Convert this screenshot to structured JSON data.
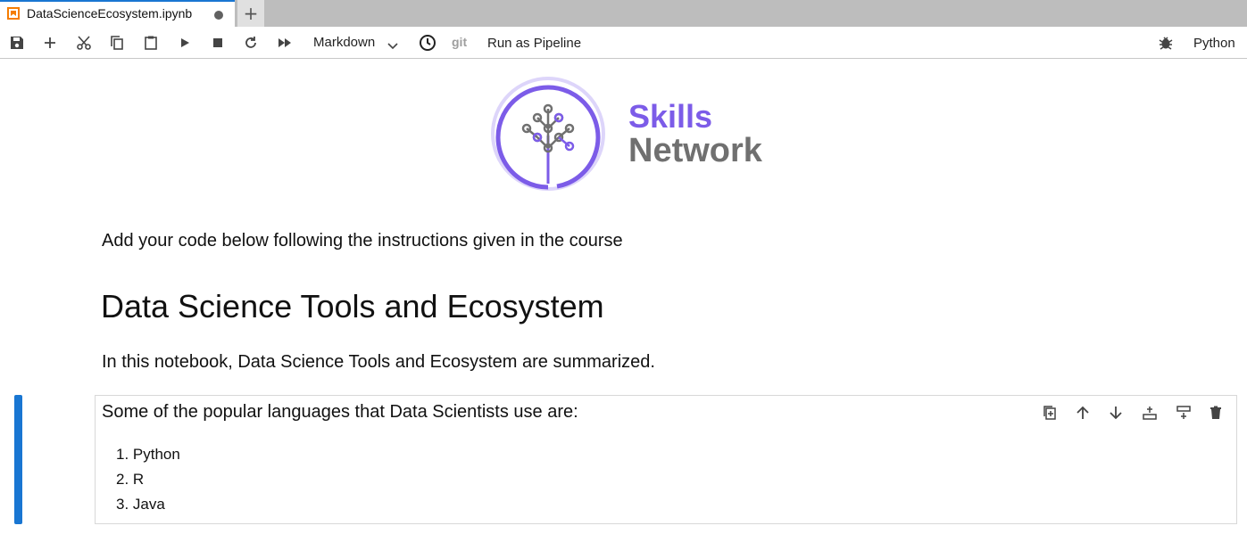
{
  "tab": {
    "title": "DataScienceEcosystem.ipynb",
    "new_tab_symbol": "+"
  },
  "toolbar": {
    "icons": [
      "save-icon",
      "add-icon",
      "cut-icon",
      "copy-icon",
      "paste-icon",
      "run-icon",
      "stop-icon",
      "restart-icon",
      "fast-forward-icon"
    ],
    "cell_type": "Markdown",
    "git_label": "git",
    "pipeline_label": "Run as Pipeline",
    "kernel_name": "Python"
  },
  "logo": {
    "line1": "Skills",
    "line2": "Network",
    "color_primary": "#7c5ce8",
    "color_secondary": "#707070"
  },
  "notebook": {
    "instruction": "Add your code below following the instructions given in the course",
    "heading": "Data Science Tools and Ecosystem",
    "intro": "In this notebook, Data Science Tools and Ecosystem are summarized.",
    "active_cell": {
      "text": "Some of the popular languages that Data Scientists use are:",
      "items": [
        "1. Python",
        "2. R",
        "3. Java"
      ],
      "tools": [
        "duplicate-icon",
        "move-up-icon",
        "move-down-icon",
        "insert-above-icon",
        "insert-below-icon",
        "delete-icon"
      ]
    }
  },
  "colors": {
    "accent": "#1976d2",
    "tab_bar": "#bdbdbd",
    "unsaved_dot": "#616161"
  }
}
